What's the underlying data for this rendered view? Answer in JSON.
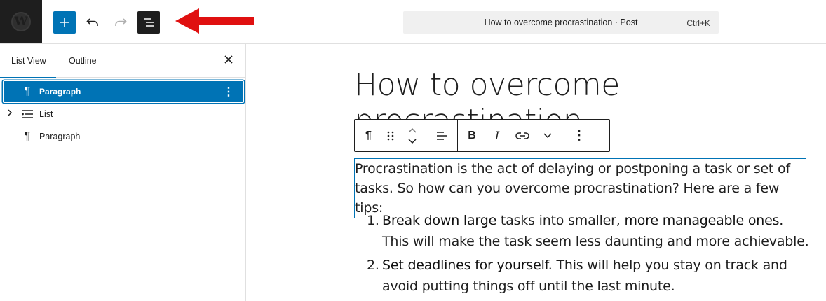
{
  "header": {
    "post_title": "How to overcome procrastination · Post",
    "shortcut": "Ctrl+K",
    "logo_icon": "wordpress-logo-icon",
    "add_icon": "plus-icon",
    "undo_icon": "undo-icon",
    "redo_icon": "redo-icon",
    "list_view_icon": "list-view-icon",
    "accent_color": "#0073b5",
    "annotation_arrow_color": "#e01010"
  },
  "sidebar": {
    "tabs": [
      {
        "label": "List View"
      },
      {
        "label": "Outline"
      }
    ],
    "close_icon": "close-icon",
    "items": [
      {
        "label": "Paragraph",
        "icon": "paragraph-icon",
        "selected": true
      },
      {
        "label": "List",
        "icon": "list-icon",
        "expandable": true
      },
      {
        "label": "Paragraph",
        "icon": "paragraph-icon",
        "selected": false
      }
    ]
  },
  "editor": {
    "title_line1": "How to overcome",
    "title_line2": "procrastination",
    "paragraph": "Procrastination is the act of delaying or postponing a task or set of tasks. So how can you overcome procrastination? Here are a few tips:",
    "list": [
      {
        "num": "1.",
        "bold1": "Break down large",
        "text1": " tasks into smaller, ",
        "bold2": "more manageable ones.",
        "text2": " This will make the task seem less daunting and more achievable."
      },
      {
        "num": "2.",
        "bold1": "Set deadlines for yourself.",
        "text1": " This will help you stay on track and avoid putting things off until the last minute."
      }
    ]
  }
}
